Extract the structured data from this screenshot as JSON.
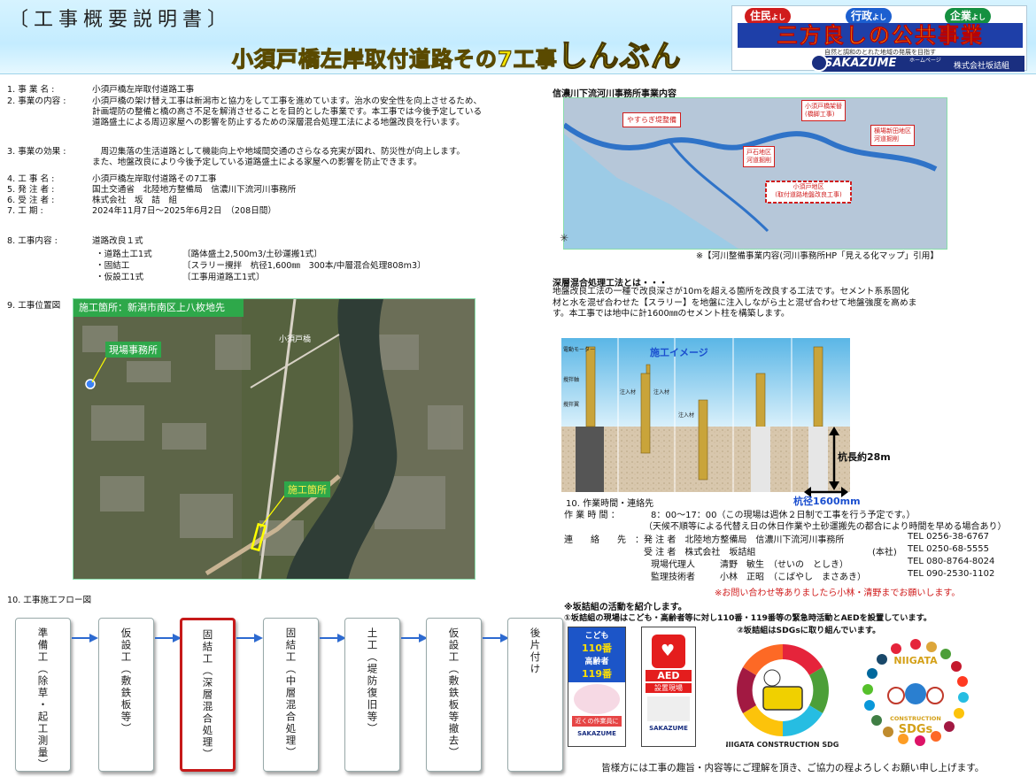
{
  "header": {
    "doc_title": "〔工事概要説明書〕",
    "news_title_main": "小須戸橋左岸取付道路その7工事",
    "news_title_big": "しんぶん",
    "pills": [
      {
        "label": "住民",
        "sub": "よし",
        "color": "#d01c1c"
      },
      {
        "label": "行政",
        "sub": "よし",
        "color": "#1c5fd0"
      },
      {
        "label": "企業",
        "sub": "よし",
        "color": "#159040"
      }
    ],
    "slogan": "三方良しの公共事業",
    "company_tagline": "自然と調和のとれた地域の発展を目指す",
    "homepage_label": "ホームページ",
    "company_logo": "SAKAZUME",
    "company_name": "株式会社坂詰組"
  },
  "overview": [
    {
      "label": "1.  事  業  名 :",
      "value": "小須戸橋左岸取付道路工事"
    },
    {
      "label": "2.  事業の内容 :",
      "value": "小須戸橋の架け替え工事は新潟市と協力をして工事を進めています。治水の安全性を向上させるため、"
    },
    {
      "label": "",
      "value": "計画堤防の整備と橋の高さ不足を解消させることを目的とした事業です。本工事では今後予定している"
    },
    {
      "label": "",
      "value": "道路盛土による周辺家屋への影響を防止するための深層混合処理工法による地盤改良を行います。"
    },
    {
      "label": "3.  事業の効果 :",
      "value": "　周辺集落の生活道路として機能向上や地域間交通のさらなる充実が図れ、防災性が向上します。"
    },
    {
      "label": "",
      "value": "また、地盤改良により今後予定している道路盛土による家屋への影響を防止できます。"
    },
    {
      "label": "4.  工  事  名 :",
      "value": "小須戸橋左岸取付道路その7工事"
    },
    {
      "label": "5.  発  注  者 :",
      "value": "国土交通省　北陸地方整備局　信濃川下流河川事務所"
    },
    {
      "label": "6.  受  注  者 :",
      "value": "株式会社　坂　詰　組"
    },
    {
      "label": "7.  工      期 :",
      "value": "2024年11月7日～2025年6月2日　（208日間）"
    },
    {
      "label": "8.  工事内容 :",
      "value": "道路改良１式"
    }
  ],
  "work_items": [
    {
      "name": "・道路土工1式",
      "detail": "〔路体盛土2,500m3/土砂運搬1式〕"
    },
    {
      "name": "・固結工",
      "detail": "〔スラリー攪拌　杭径1,600㎜　300本/中層混合処理808m3〕"
    },
    {
      "name": "・仮設工1式",
      "detail": "〔工事用道路工1式〕"
    }
  ],
  "location": {
    "heading": "9.  工事位置図",
    "banner": "施工箇所：新潟市南区上八枚地先",
    "office_label": "現場事務所",
    "site_label": "施工箇所",
    "river_label": "小須戸橋"
  },
  "river_map": {
    "heading": "信濃川下流河川事務所事業内容",
    "labels": [
      "やすらぎ堤整備",
      "小須戸橋架替\n(橋脚工事)",
      "横場新田地区\n河道掘削",
      "戸石地区\n河道掘削",
      "小須戸地区\n(取付道路地盤改良工事)"
    ],
    "caption": "※【河川整備事業内容(河川事務所HP「見える化マップ」引用】"
  },
  "method": {
    "heading": "深層混合処理工法とは・・・",
    "lines": [
      "地盤改良工法の一種で改良深さが10mを超える箇所を改良する工法です。セメント系系固化",
      "材と水を混ぜ合わせた【スラリー】を地盤に注入しながら土と混ぜ合わせて地盤強度を高めま",
      "す。本工事では地中に計1600㎜のセメント柱を構築します。"
    ],
    "image_title": "施工イメージ",
    "pile_length": "杭長約28m",
    "pile_diameter": "杭径1600mm",
    "annotations": [
      "電動モーター",
      "攪拌軸",
      "攪拌翼",
      "注入材",
      "注入材",
      "注入材"
    ]
  },
  "contact": {
    "heading": "10.  作業時間・連絡先",
    "hours_label": "作  業  時  間  ：",
    "hours_value": "8：00～17：00（この現場は週休２日制で工事を行う予定です。）",
    "hours_note": "（天候不順等による代替え日の休日作業や土砂運搬先の都合により時間を早める場合あり）",
    "contact_label": "連　　絡　　先　：",
    "rows": [
      {
        "role": "発 注 者　北陸地方整備局　信濃川下流河川事務所",
        "tel": "TEL 0256-38-6767"
      },
      {
        "role": "受 注 者　株式会社　坂詰組",
        "extra": "(本社)",
        "tel": "TEL 0250-68-5555"
      },
      {
        "role": "現場代理人",
        "person": "清野　敏生　（せいの　としき）",
        "tel": "TEL 080-8764-8024"
      },
      {
        "role": "監理技術者",
        "person": "小林　正昭　（こばやし　まさあき）",
        "tel": "TEL 090-2530-1102"
      }
    ],
    "note": "※お問い合わせ等ありましたら小林・清野までお願いします。"
  },
  "flow": {
    "heading": "10.  工事施工フロー図",
    "steps": [
      {
        "text": "準備工（除草・起工測量）",
        "highlight": false
      },
      {
        "text": "仮設工（敷鉄板等）",
        "highlight": false
      },
      {
        "text": "固結工（深層混合処理）",
        "highlight": true
      },
      {
        "text": "固結工（中層混合処理）",
        "highlight": false
      },
      {
        "text": "土工（堤防復旧等）",
        "highlight": false
      },
      {
        "text": "仮設工（敷鉄板等撤去）",
        "highlight": false
      },
      {
        "text": "後片付け",
        "highlight": false
      }
    ]
  },
  "activities": {
    "heading": "※坂詰組の活動を紹介します。",
    "line1": "①坂詰組の現場はこども・高齢者等に対し110番・119番等の緊急時活動とAEDを設置しています。",
    "line2": "②坂詰組はSDGsに取り組んでいます。",
    "poster1_lines": [
      "こども",
      "110番",
      "高齢者",
      "119番",
      "近くの作業員に",
      "SAKAZUME"
    ],
    "poster2_lines": [
      "AED",
      "設置現場",
      "SAKAZUME"
    ],
    "sdg1_text": "NIIGATA CONSTRUCTION SDGs",
    "sdg2_top": "NIIGATA",
    "sdg2_mid": "CONSTRUCTION",
    "sdg2_bottom": "SDGs",
    "closing": "皆様方には工事の趣旨・内容等にご理解を頂き、ご協力の程よろしくお願い申し上げます。"
  }
}
